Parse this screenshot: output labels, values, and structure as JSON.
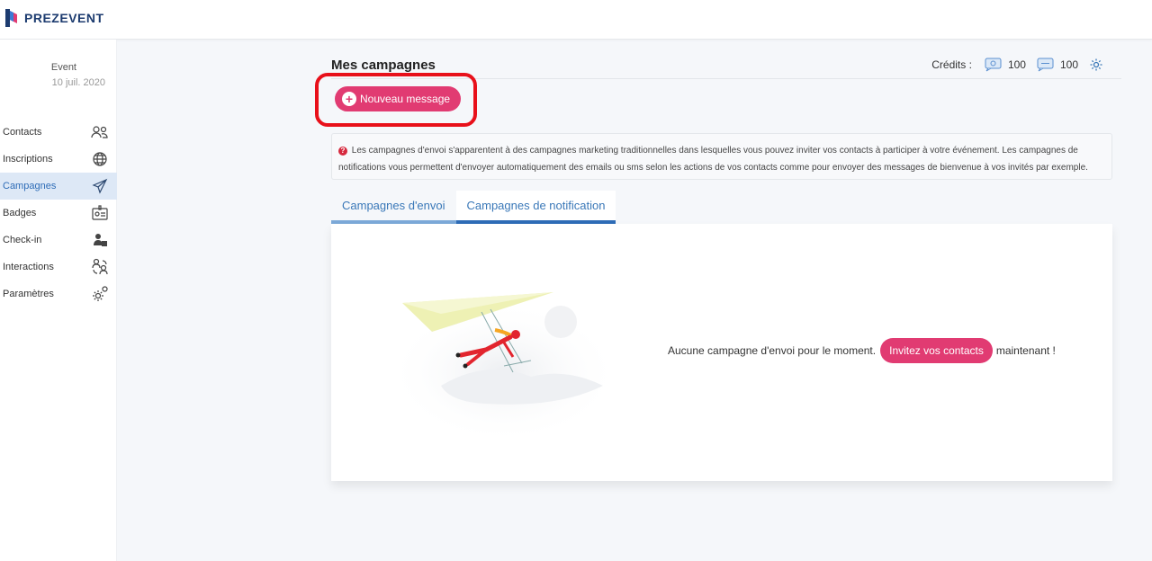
{
  "app": {
    "name": "PREZEVENT"
  },
  "event": {
    "name": "Event",
    "date": "10 juil. 2020"
  },
  "sidebar": {
    "items": [
      {
        "label": "Contacts",
        "icon": "contacts-icon"
      },
      {
        "label": "Inscriptions",
        "icon": "globe-icon"
      },
      {
        "label": "Campagnes",
        "icon": "paper-plane-icon",
        "active": true
      },
      {
        "label": "Badges",
        "icon": "badge-icon"
      },
      {
        "label": "Check-in",
        "icon": "check-in-icon"
      },
      {
        "label": "Interactions",
        "icon": "interactions-icon"
      },
      {
        "label": "Paramètres",
        "icon": "gear-icon"
      }
    ]
  },
  "page": {
    "title": "Mes campagnes",
    "credits_label": "Crédits :",
    "email_credits": "100",
    "sms_credits": "100",
    "new_message_label": "Nouveau message",
    "info_text": "Les campagnes d'envoi s'apparentent à des campagnes marketing traditionnelles dans lesquelles vous pouvez inviter vos contacts à participer à votre événement. Les campagnes de notifications vous permettent d'envoyer automatiquement des emails ou sms selon les actions de vos contacts comme pour envoyer des messages de bienvenue à vos invités par exemple.",
    "tabs": [
      {
        "label": "Campagnes d'envoi"
      },
      {
        "label": "Campagnes de notification",
        "active": true
      }
    ],
    "empty_text_before": "Aucune campagne d'envoi pour le moment.",
    "invite_label": "Invitez vos contacts",
    "empty_text_after": "maintenant !"
  },
  "colors": {
    "accent": "#e13b72",
    "primary": "#2e6cb7",
    "highlight": "#e8101a"
  }
}
